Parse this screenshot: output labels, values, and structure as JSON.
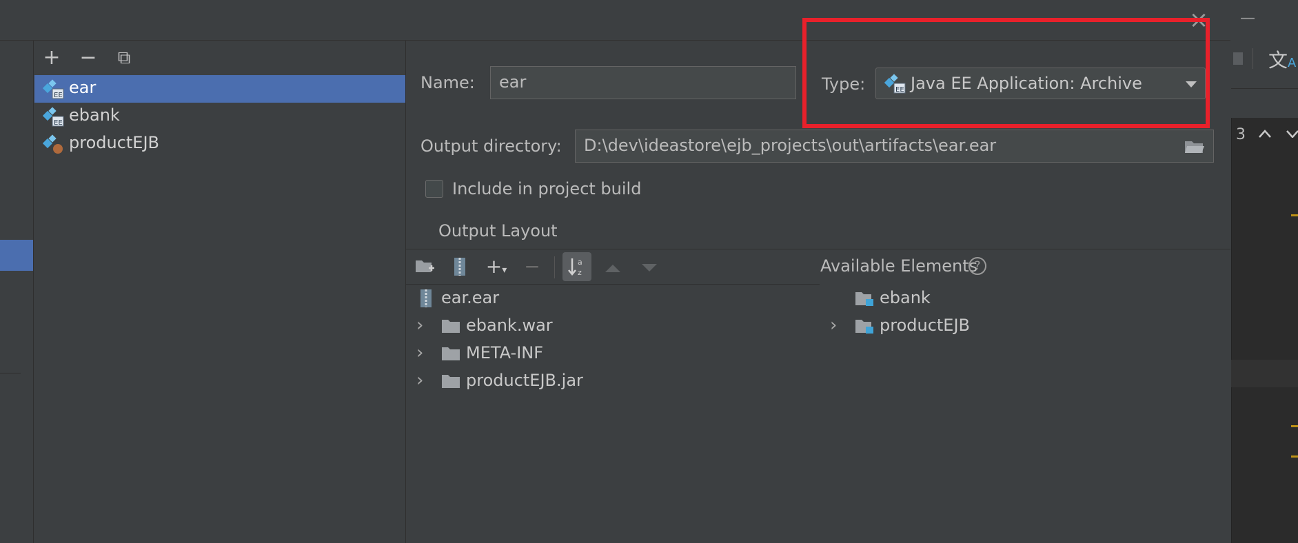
{
  "toolbar": {
    "add": "+",
    "remove": "−",
    "copy": "⧉"
  },
  "artifacts": [
    {
      "label": "ear",
      "selected": true,
      "icon": "java-ee-icon"
    },
    {
      "label": "ebank",
      "selected": false,
      "icon": "java-ee-icon"
    },
    {
      "label": "productEJB",
      "selected": false,
      "icon": "ejb-icon"
    }
  ],
  "form": {
    "name_label": "Name:",
    "name_value": "ear",
    "type_label": "Type:",
    "type_value": "Java EE Application: Archive",
    "output_dir_label": "Output directory:",
    "output_dir_value": "D:\\dev\\ideastore\\ejb_projects\\out\\artifacts\\ear.ear",
    "include_label": "Include in project build",
    "include_checked": false
  },
  "output_layout": {
    "tab_label": "Output Layout",
    "root": "ear.ear",
    "children": [
      "ebank.war",
      "META-INF",
      "productEJB.jar"
    ]
  },
  "available": {
    "title": "Available Elements",
    "help_glyph": "?",
    "items": [
      "ebank",
      "productEJB"
    ]
  },
  "right_panel": {
    "counter": "3"
  },
  "colors": {
    "selection": "#4b6eaf",
    "highlight": "#e8212b",
    "background": "#3c3f41"
  }
}
